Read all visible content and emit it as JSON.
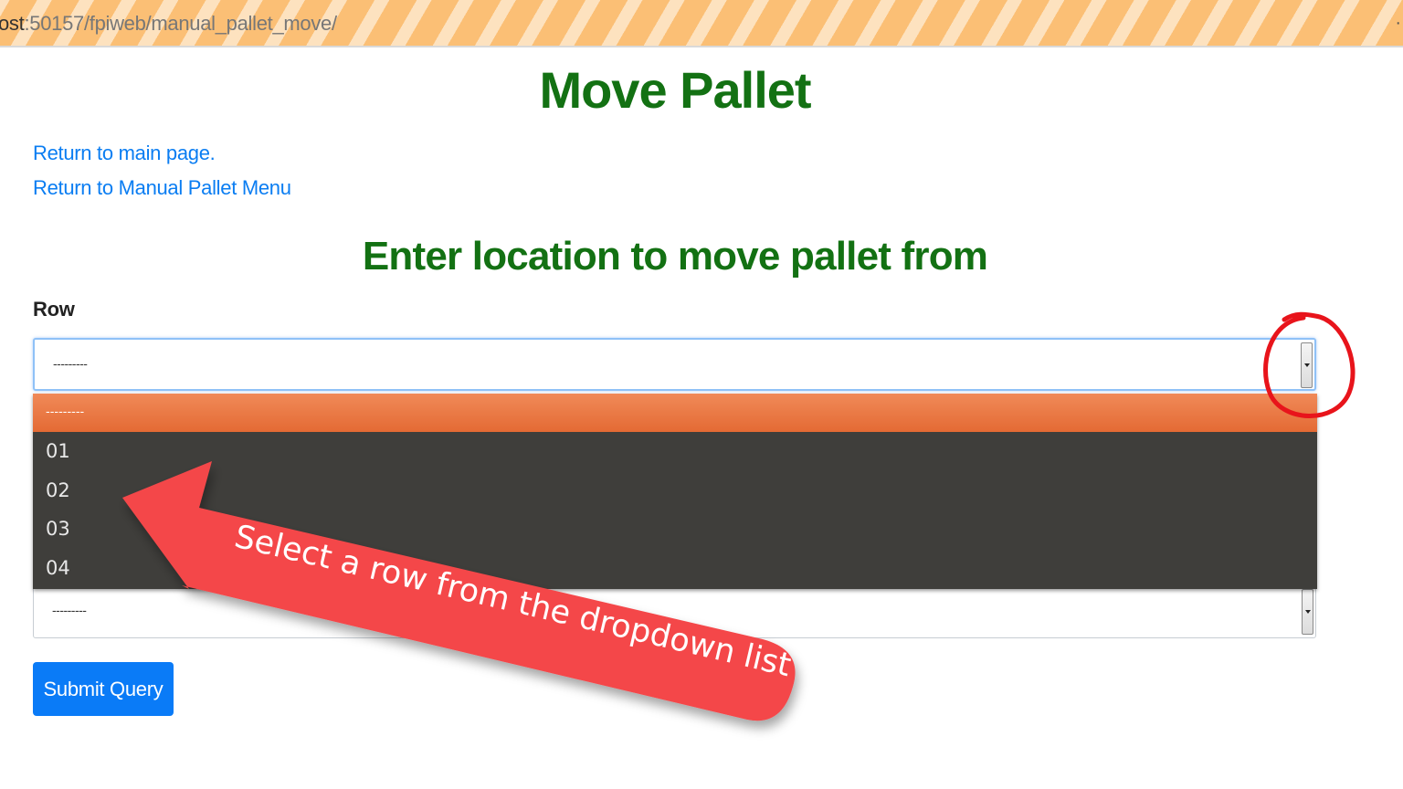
{
  "browser": {
    "url_host": "ost",
    "url_rest": ":50157/fpiweb/manual_pallet_move/",
    "overflow_indicator": "·"
  },
  "page": {
    "title": "Move Pallet",
    "links": [
      {
        "label": "Return to main page."
      },
      {
        "label": "Return to Manual Pallet Menu"
      }
    ],
    "subtitle": "Enter location to move pallet from",
    "row_label": "Row",
    "row_select": {
      "value": "---------",
      "options": [
        "---------",
        "01",
        "02",
        "03",
        "04"
      ],
      "highlighted_option": "---------"
    },
    "second_select": {
      "value": "---------"
    },
    "submit_label": "Submit Query"
  },
  "annotations": {
    "callout_text": "Select a row from the dropdown list",
    "arrow_color": "#f4474a",
    "circle_color": "#e8141b"
  },
  "colors": {
    "heading": "#137113",
    "link": "#0a7df2",
    "button": "#0a7bf7",
    "dropdown_bg": "#3f3e3b",
    "dropdown_highlight": "#e9733f"
  }
}
